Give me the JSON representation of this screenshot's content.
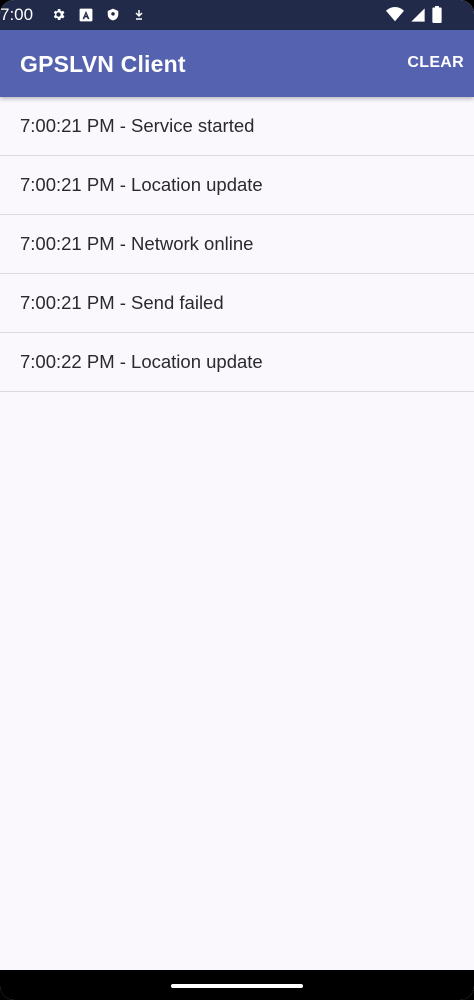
{
  "status_bar": {
    "time": "7:00",
    "left_icons": [
      "gear-icon",
      "a-icon",
      "shield-icon",
      "download-icon"
    ],
    "right_icons": [
      "wifi-icon",
      "signal-icon",
      "battery-icon"
    ]
  },
  "app_bar": {
    "title": "GPSLVN Client",
    "clear_label": "CLEAR",
    "color": "#5562b0"
  },
  "log": {
    "items": [
      "7:00:21 PM - Service started",
      "7:00:21 PM - Location update",
      "7:00:21 PM - Network online",
      "7:00:21 PM - Send failed",
      "7:00:22 PM - Location update"
    ]
  }
}
